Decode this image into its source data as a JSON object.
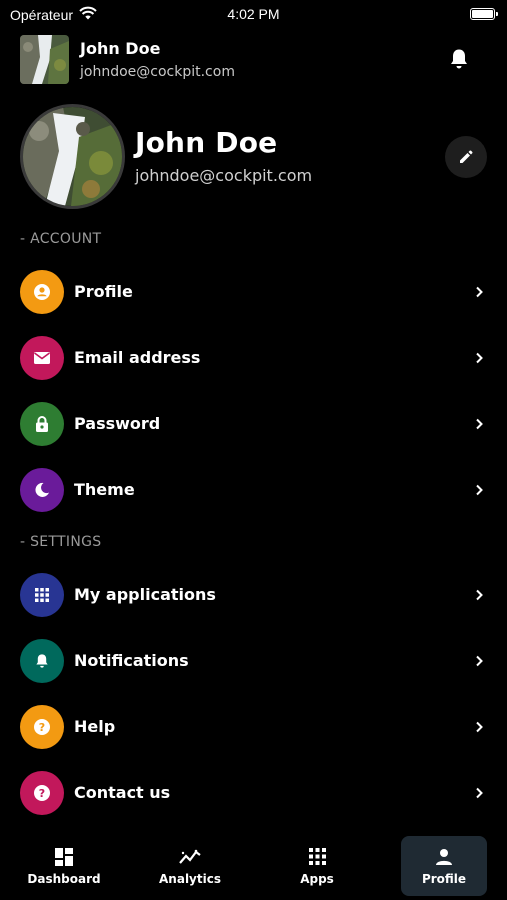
{
  "status_bar": {
    "carrier": "Opérateur",
    "time": "4:02 PM"
  },
  "header": {
    "name": "John Doe",
    "email": "johndoe@cockpit.com",
    "bell_icon": "bell-icon"
  },
  "profile": {
    "name": "John Doe",
    "email": "johndoe@cockpit.com",
    "edit_icon": "pencil-icon"
  },
  "sections": {
    "account": {
      "title": "- ACCOUNT",
      "items": [
        {
          "label": "Profile",
          "icon": "person-icon",
          "color": "#f39a12"
        },
        {
          "label": "Email address",
          "icon": "mail-icon",
          "color": "#c2185b"
        },
        {
          "label": "Password",
          "icon": "lock-icon",
          "color": "#2e7d32"
        },
        {
          "label": "Theme",
          "icon": "moon-icon",
          "color": "#6a1b9a"
        }
      ]
    },
    "settings": {
      "title": "- SETTINGS",
      "items": [
        {
          "label": "My applications",
          "icon": "grid-icon",
          "color": "#283593"
        },
        {
          "label": "Notifications",
          "icon": "bell-icon",
          "color": "#00695c"
        },
        {
          "label": "Help",
          "icon": "help-icon",
          "color": "#f39a12"
        },
        {
          "label": "Contact us",
          "icon": "question-icon",
          "color": "#c2185b"
        }
      ]
    }
  },
  "bottom_nav": {
    "tabs": [
      {
        "label": "Dashboard",
        "icon": "dashboard-icon",
        "active": false
      },
      {
        "label": "Analytics",
        "icon": "analytics-icon",
        "active": false
      },
      {
        "label": "Apps",
        "icon": "apps-icon",
        "active": false
      },
      {
        "label": "Profile",
        "icon": "person-icon",
        "active": true
      }
    ],
    "active_color": "#1f2a33"
  }
}
